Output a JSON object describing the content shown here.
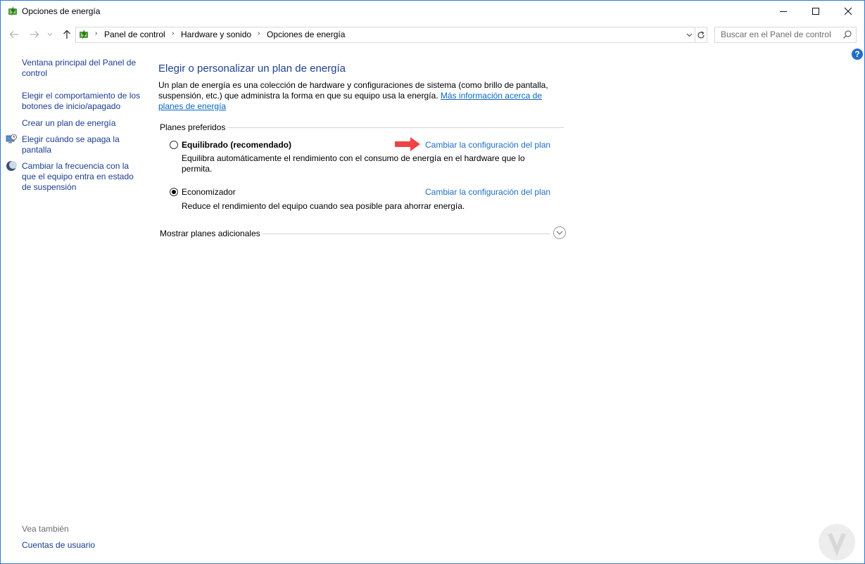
{
  "window": {
    "title": "Opciones de energía"
  },
  "address_bar": {
    "breadcrumbs": [
      "Panel de control",
      "Hardware y sonido",
      "Opciones de energía"
    ]
  },
  "search": {
    "placeholder": "Buscar en el Panel de control"
  },
  "help": {
    "label": "?"
  },
  "sidebar": {
    "links": [
      {
        "label": "Ventana principal del Panel de control"
      },
      {
        "label": "Elegir el comportamiento de los botones de inicio/apagado"
      },
      {
        "label": "Crear un plan de energía"
      },
      {
        "label": "Elegir cuándo se apaga la pantalla",
        "icon": "screen-clock-icon"
      },
      {
        "label": "Cambiar la frecuencia con la que el equipo entra en estado de suspensión",
        "icon": "moon-icon"
      }
    ],
    "see_also_title": "Vea también",
    "see_also_links": [
      {
        "label": "Cuentas de usuario"
      }
    ]
  },
  "main": {
    "heading": "Elegir o personalizar un plan de energía",
    "description": "Un plan de energía es una colección de hardware y configuraciones de sistema (como brillo de pantalla, suspensión, etc.) que administra la forma en que su equipo usa la energía.",
    "description_link": "Más información acerca de planes de energía",
    "group_title": "Planes preferidos",
    "plans": [
      {
        "name": "Equilibrado (recomendado)",
        "selected": false,
        "description": "Equilibra automáticamente el rendimiento con el consumo de energía en el hardware que lo permita.",
        "link": "Cambiar la configuración del plan"
      },
      {
        "name": "Economizador",
        "selected": true,
        "description": "Reduce el rendimiento del equipo cuando sea posible para ahorrar energía.",
        "link": "Cambiar la configuración del plan"
      }
    ],
    "more_plans": "Mostrar planes adicionales"
  },
  "colors": {
    "link": "#1f6fc7",
    "heading": "#1e3f8f",
    "sidebar_link": "#1a3d8f",
    "arrow": "#ee4444"
  }
}
